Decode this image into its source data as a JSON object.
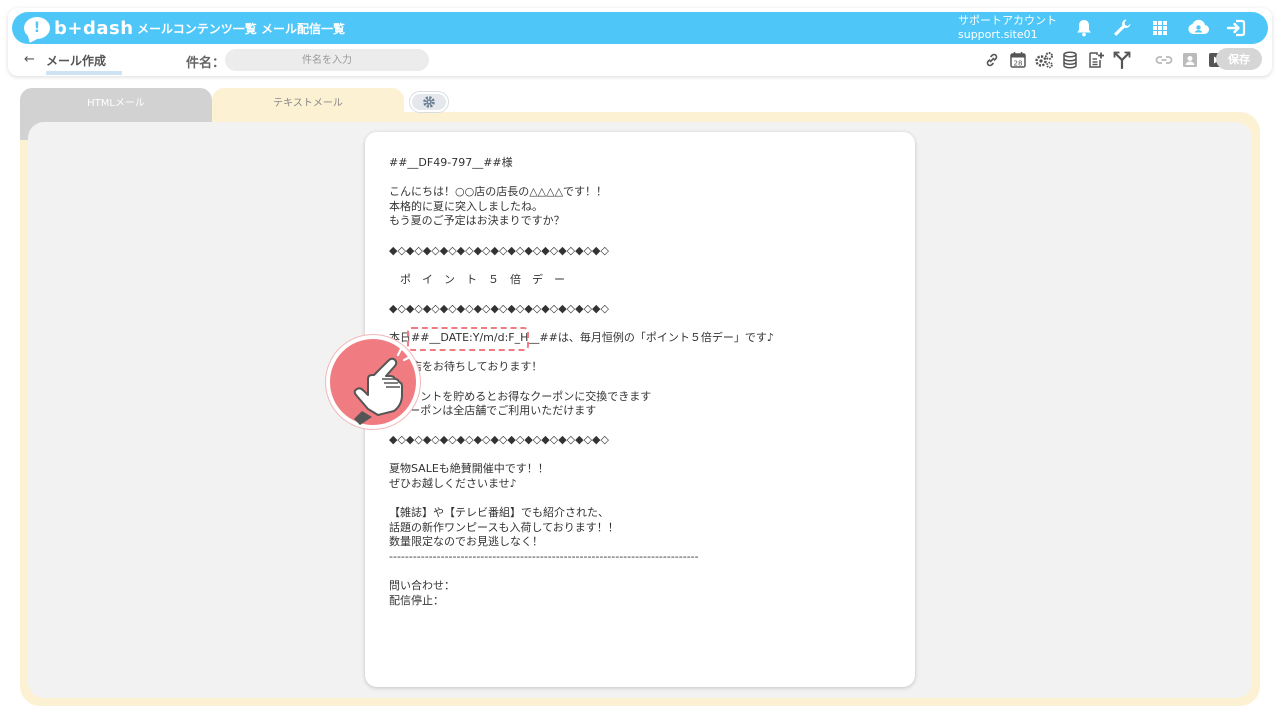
{
  "app": {
    "logo_text": "b+dash",
    "logo_mark": "!",
    "brand_color": "#4ec7f8"
  },
  "nav": {
    "items": [
      {
        "label": "メールコンテンツ一覧"
      },
      {
        "label": "メール配信一覧"
      }
    ]
  },
  "account": {
    "name": "サポートアカウント",
    "site": "support.site01"
  },
  "top_icons": [
    "bell-icon",
    "wrench-icon",
    "grid-icon",
    "cloud-user-icon",
    "logout-icon"
  ],
  "page": {
    "back_symbol": "←",
    "title": "メール作成",
    "subject_label": "件名：",
    "subject_placeholder": "件名を入力",
    "subject_value": ""
  },
  "tools": [
    "link-icon",
    "calendar-icon",
    "gears-icon",
    "database-icon",
    "add-doc-icon",
    "branch-icon",
    "link-disabled-icon",
    "user-card-icon",
    "play-icon"
  ],
  "calendar_day": "28",
  "save_label": "保存",
  "tabs": [
    {
      "label": "HTMLメール",
      "active": false
    },
    {
      "label": "テキストメール",
      "active": true
    }
  ],
  "settings_icon": "gear-icon",
  "mail_lines": [
    "##__DF49-797__##様",
    "",
    "こんにちは！○○店の店長の△△△△です！！",
    "本格的に夏に突入しましたね。",
    "もう夏のご予定はお決まりですか？",
    "",
    "◆◇◆◇◆◇◆◇◆◇◆◇◆◇◆◇◆◇◆◇◆◇◆◇◆◇",
    "",
    "　ポ　イ　ン　ト　５　倍　デ　ー",
    "",
    "◆◇◆◇◆◇◆◇◆◇◆◇◆◇◆◇◆◇◆◇◆◇◆◇◆◇",
    "",
    "本日##__DATE:Y/m/d:F_H__##は、毎月恒例の「ポイント５倍デー」です♪",
    "",
    "ご来店をお待ちしております！",
    "",
    "※ポイントを貯めるとお得なクーポンに交換できます",
    "※クーポンは全店舗でご利用いただけます",
    "",
    "◆◇◆◇◆◇◆◇◆◇◆◇◆◇◆◇◆◇◆◇◆◇◆◇◆◇",
    "",
    "夏物SALEも絶賛開催中です！！",
    "ぜひお越しくださいませ♪",
    "",
    "【雑誌】や【テレビ番組】でも紹介された、",
    "話題の新作ワンピースも入荷しております！！",
    "数量限定なのでお見逃しなく！",
    "------------------------------------------------------------------------------",
    "",
    "問い合わせ：",
    "配信停止："
  ],
  "annotation": {
    "highlight_color": "#f07c82",
    "pointer_icon": "pointing-hand-icon"
  }
}
